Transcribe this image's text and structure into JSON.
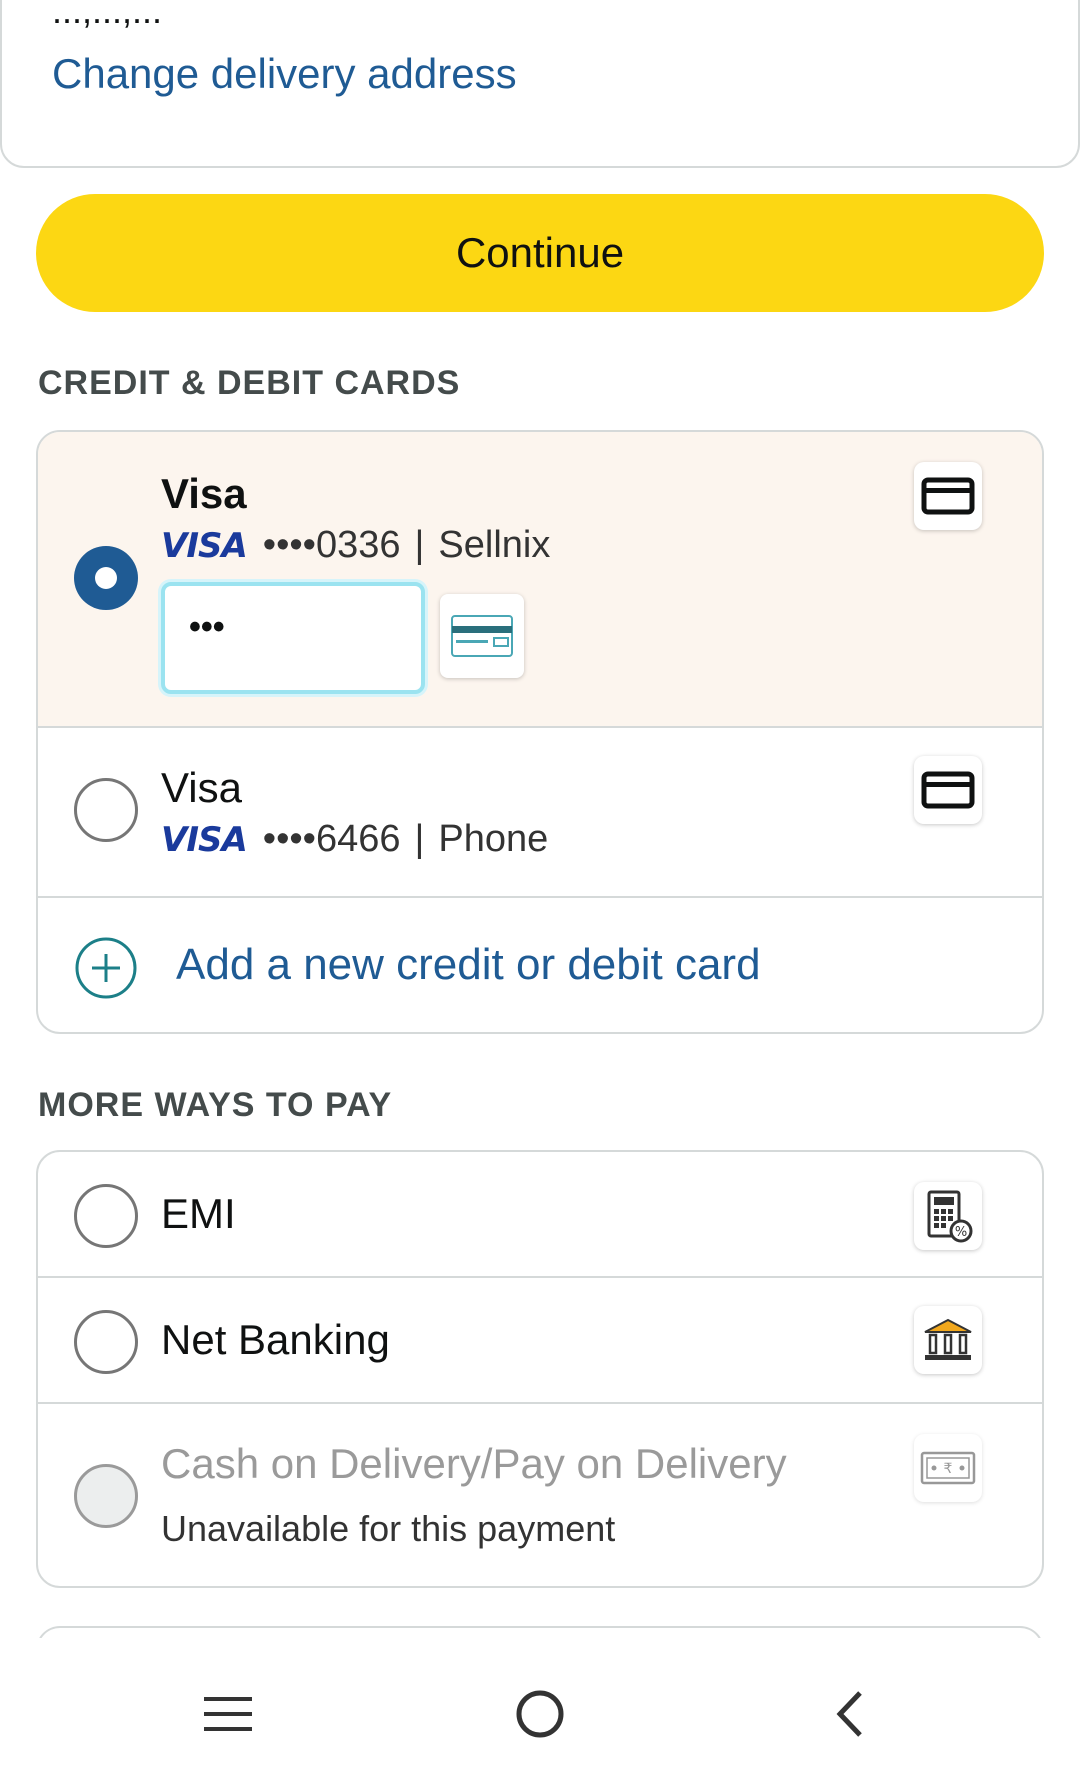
{
  "address_card": {
    "cut_text": "...,...,...",
    "change_address_link": "Change delivery address"
  },
  "continue_button": "Continue",
  "cards_section": {
    "heading": "CREDIT & DEBIT CARDS",
    "cards": [
      {
        "name": "Visa",
        "brand": "VISA",
        "masked_number": "••••0336",
        "separator": "|",
        "nickname": "Sellnix",
        "selected": true,
        "cvv_value": "•••",
        "icon": "credit-card-icon"
      },
      {
        "name": "Visa",
        "brand": "VISA",
        "masked_number": "••••6466",
        "separator": "|",
        "nickname": "Phone",
        "selected": false,
        "icon": "credit-card-icon"
      }
    ],
    "add_card_label": "Add a new credit or debit card"
  },
  "more_ways_section": {
    "heading": "MORE WAYS TO PAY",
    "options": [
      {
        "label": "EMI",
        "icon": "emi-calculator-icon"
      },
      {
        "label": "Net Banking",
        "icon": "bank-icon"
      },
      {
        "label": "Cash on Delivery/Pay on Delivery",
        "sublabel": "Unavailable for this payment",
        "icon": "cash-icon",
        "disabled": true
      }
    ]
  },
  "colors": {
    "accent": "#1f5b94",
    "continue_bg": "#fcd713",
    "selected_row_bg": "#fcf5ee",
    "border": "#d5d9d9"
  },
  "nav_bar": [
    "menu-icon",
    "home-icon",
    "back-icon"
  ]
}
